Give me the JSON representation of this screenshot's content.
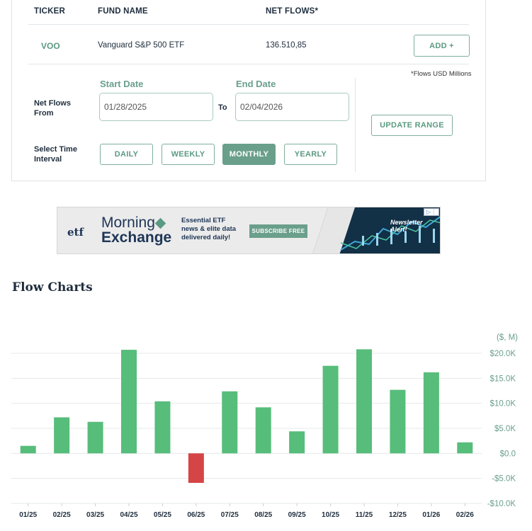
{
  "table": {
    "headers": {
      "ticker": "TICKER",
      "fund_name": "FUND NAME",
      "net_flows": "NET FLOWS*"
    },
    "row": {
      "ticker": "VOO",
      "fund_name": "Vanguard S&P 500 ETF",
      "net_flows": "136.510,85",
      "add_label": "ADD +"
    },
    "footnote": "*Flows USD Millions"
  },
  "filters": {
    "net_flows_from_label": "Net Flows From",
    "start_date_label": "Start Date",
    "start_date_value": "01/28/2025",
    "to_label": "To",
    "end_date_label": "End Date",
    "end_date_value": "02/04/2026",
    "update_label": "UPDATE RANGE",
    "interval_label": "Select Time Interval",
    "intervals": [
      "DAILY",
      "WEEKLY",
      "MONTHLY",
      "YEARLY"
    ],
    "selected_interval": "MONTHLY"
  },
  "ad": {
    "logo_small": "etf",
    "brand_line1": "Morning",
    "brand_line2": "Exchange",
    "tagline": [
      "Essential ETF",
      "news & elite data",
      "delivered daily!"
    ],
    "subscribe_label": "SUBSCRIBE FREE",
    "alert_label": "Newsletter Alert!"
  },
  "section_title": "Flow Charts",
  "colors": {
    "accent": "#6a9f8c",
    "positive": "#57bd7a",
    "negative": "#d64545"
  },
  "chart_data": {
    "type": "bar",
    "unit_label": "($, M)",
    "categories": [
      "01/25",
      "02/25",
      "03/25",
      "04/25",
      "05/25",
      "06/25",
      "07/25",
      "08/25",
      "09/25",
      "10/25",
      "11/25",
      "12/25",
      "01/26",
      "02/26"
    ],
    "values": [
      1500,
      7200,
      6300,
      20700,
      10400,
      -5900,
      12400,
      9200,
      4400,
      17500,
      20800,
      12700,
      16200,
      2200
    ],
    "ylim": [
      -10000,
      20000
    ],
    "yticks": [
      20000,
      15000,
      10000,
      5000,
      0,
      -5000,
      -10000
    ],
    "ytick_labels": [
      "$20.0K",
      "$15.0K",
      "$10.0K",
      "$5.0K",
      "$0.0",
      "-$5.0K",
      "-$10.0K"
    ],
    "grid": true
  }
}
